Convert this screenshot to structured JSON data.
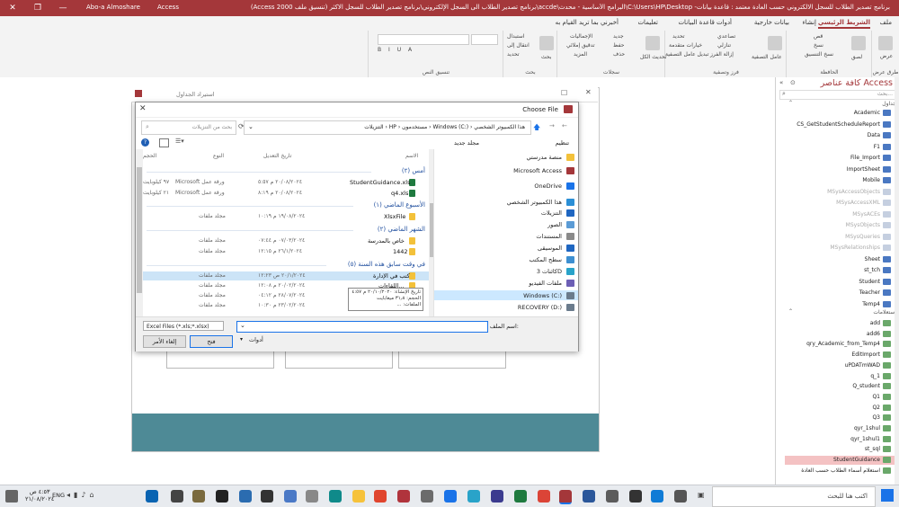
{
  "titlebar": {
    "user": "Abo-a Almoshare",
    "title": "برنامج تصدير الطلاب للسجل الالكتروني حسب العادة معتمد : قاعدة بيانات- C:\\Users\\HP\\Desktop\\البرامج الأساسية - محدث\\accde\\برنامج تصدير الطلاب الى السجل الإلكتروني\\برنامج تصدير الطلاب للسجل الاكثر (تنسيق ملف Access 2000)",
    "app": "Access"
  },
  "tabs": [
    "ملف",
    "الشريط الرئيسي",
    "إنشاء",
    "بيانات خارجية",
    "أدوات قاعدة البيانات",
    "تعليمات",
    "أخبرني بما تريد القيام به"
  ],
  "ribbon": {
    "groups": [
      "طرق عرض",
      "الحافظة",
      "فرز وتصفية",
      "سجلات",
      "بحث",
      "تنسيق النص"
    ],
    "items": {
      "view": "عرض",
      "paste": "لصق",
      "cut": "قص",
      "copy": "نسخ",
      "format_painter": "نسخ التنسيق",
      "filter": "عامل التصفية",
      "ascending": "تصاعدي",
      "descending": "تنازلي",
      "remove_sort": "إزالة الفرز",
      "selection": "تحديد",
      "advanced": "خيارات متقدمة",
      "toggle_filter": "تبديل عامل التصفية",
      "refresh_all": "تحديث الكل",
      "new": "جديد",
      "save": "حفظ",
      "delete": "حذف",
      "totals": "الإجماليات",
      "spelling": "تدقيق إملائي",
      "more": "المزيد",
      "find": "بحث",
      "replace": "استبدال",
      "goto": "انتقال إلى",
      "select": "تحديد"
    }
  },
  "import_dialog": {
    "title": "استيراد الجداول"
  },
  "choose_file": {
    "title": "Choose File",
    "address": [
      "هذا الكمبيوتر الشخصي",
      "Windows (C:)",
      "مستخدمون",
      "HP",
      "التنزيلات"
    ],
    "search_placeholder": "بحث من التنزيلات",
    "organize": "تنظيم",
    "new_folder": "مجلد جديد",
    "columns": {
      "name": "الاسم",
      "modified": "تاريخ التعديل",
      "type": "النوع",
      "size": "الحجم"
    },
    "groups": [
      {
        "label": "أمس (٢)",
        "files": [
          {
            "name": "StudentGuidance.xls",
            "modified": "٢٠/٠٨/٢٠٢٤ م ٥:٥٧",
            "type": "Microsoft ورقة عمل",
            "size": "٩٧ كيلوبايت"
          },
          {
            "name": "q4.xls",
            "modified": "٢٠/٠٨/٢٠٢٤ م ٨:١٩",
            "type": "Microsoft ورقة عمل",
            "size": "٢١ كيلوبايت"
          }
        ]
      },
      {
        "label": "الأسبوع الماضي (١)",
        "files": [
          {
            "name": "XlsxFile",
            "modified": "١٩/٠٨/٢٠٢٤ م ١٠:١٩",
            "type": "مجلد ملفات",
            "size": ""
          }
        ]
      },
      {
        "label": "الشهر الماضي (٢)",
        "files": [
          {
            "name": "خاص بالمدرسة",
            "modified": "٠٧/٠٣/٢٠٢٤ م ٠٧:٤٤",
            "type": "مجلد ملفات",
            "size": ""
          },
          {
            "name": "1442",
            "modified": "٢٦/١/٢٠٢٤ م ١٢:١٥",
            "type": "مجلد ملفات",
            "size": ""
          }
        ]
      },
      {
        "label": "في وقت سابق هذه السنة (٥)",
        "files": [
          {
            "name": "كتب في الإدارة",
            "modified": "٢٠/١/٢٠٢٤ ص ١٢:٢٣",
            "type": "مجلد ملفات",
            "size": ""
          },
          {
            "name": "اللقاءات...",
            "modified": "٢٠/٠٢/٢٠٢٤ م ١٢:٠٨",
            "type": "مجلد ملفات",
            "size": ""
          },
          {
            "name": "",
            "modified": "٢٨/٠٧/٢٠٢٤ م ٠٤:١٢",
            "type": "مجلد ملفات",
            "size": ""
          },
          {
            "name": "",
            "modified": "٢٣/٠٢/٢٠٢٤ م ١٠:٣٠",
            "type": "مجلد ملفات",
            "size": ""
          }
        ]
      }
    ],
    "tooltip": [
      "تاريخ الإنشاء: ٢٠/١٠/٢٠٢٠ م ٤:٥٧",
      "الحجم: ٣١٫٨ ميغابايت",
      "الملفات: ..."
    ],
    "nav": [
      "منصة مدرستي",
      "Microsoft Access",
      "OneDrive",
      "هذا الكمبيوتر الشخصي",
      "التنزيلات",
      "الصور",
      "المستندات",
      "الموسيقى",
      "سطح المكتب",
      "كائنات 3D",
      "ملفات الفيديو",
      "Windows (C:)",
      "RECOVERY (D:)"
    ],
    "filename_label": "اسم الملف:",
    "filter": "Excel Files (*.xls;*.xlsx)",
    "tools": "أدوات",
    "open": "فتح",
    "cancel": "إلغاء الأمر"
  },
  "navpane": {
    "title": "كافة عناصر Access",
    "search_placeholder": "بحث...",
    "tables_header": "جداول",
    "tables": [
      {
        "name": "Academic",
        "gray": false
      },
      {
        "name": "CS_GetStudentScheduleReport",
        "gray": false
      },
      {
        "name": "Data",
        "gray": false
      },
      {
        "name": "F1",
        "gray": false
      },
      {
        "name": "File_Import",
        "gray": false
      },
      {
        "name": "ImportSheet",
        "gray": false
      },
      {
        "name": "Mobile",
        "gray": false
      },
      {
        "name": "MSysAccessObjects",
        "gray": true
      },
      {
        "name": "MSysAccessXML",
        "gray": true
      },
      {
        "name": "MSysACEs",
        "gray": true
      },
      {
        "name": "MSysObjects",
        "gray": true
      },
      {
        "name": "MSysQueries",
        "gray": true
      },
      {
        "name": "MSysRelationships",
        "gray": true
      },
      {
        "name": "Sheet",
        "gray": false
      },
      {
        "name": "st_tch",
        "gray": false
      },
      {
        "name": "Student",
        "gray": false
      },
      {
        "name": "Teacher",
        "gray": false
      },
      {
        "name": "Temp4",
        "gray": false
      }
    ],
    "queries_header": "استعلامات",
    "queries": [
      "add",
      "add6",
      "qry_Academic_from_Temp4",
      "EditImport",
      "uPDATmWAD",
      "q_1",
      "Q_student",
      "Q1",
      "Q2",
      "Q3",
      "qyr_1shul",
      "qyr_1shul1",
      "st_sql",
      "StudentGuidance",
      "استعلام أسماء الطلاب حسب العادة"
    ]
  },
  "taskbar": {
    "search": "اكتب هنا للبحث",
    "lang": "ENG",
    "time": "٤:٥٣ ص",
    "date": "٢١/٠٨/٢٠٢٤"
  }
}
